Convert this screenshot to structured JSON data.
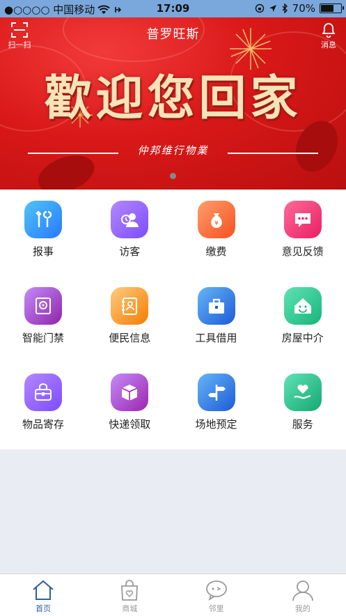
{
  "status_bar": {
    "carrier": "●○○○○ 中国移动",
    "time": "17:09",
    "battery_text": "70%",
    "battery_level": 0.7
  },
  "banner": {
    "scan_label": "扫一扫",
    "title": "普罗旺斯",
    "message_label": "消息",
    "welcome_text": "歡迎您回家",
    "brand_text": "仲邦维行物業"
  },
  "services": [
    {
      "label": "报事",
      "icon": "wrench-screwdriver-icon",
      "color_from": "#4fc3f7",
      "color_to": "#2979ff"
    },
    {
      "label": "访客",
      "icon": "visitor-icon",
      "color_from": "#b388ff",
      "color_to": "#7c4dff"
    },
    {
      "label": "缴费",
      "icon": "money-bag-icon",
      "color_from": "#ff9e6d",
      "color_to": "#f4511e"
    },
    {
      "label": "意见反馈",
      "icon": "chat-bubble-icon",
      "color_from": "#ff6b9a",
      "color_to": "#e91e63"
    },
    {
      "label": "智能门禁",
      "icon": "safe-icon",
      "color_from": "#c58af9",
      "color_to": "#8e24aa"
    },
    {
      "label": "便民信息",
      "icon": "contact-book-icon",
      "color_from": "#ffcc80",
      "color_to": "#f57c00"
    },
    {
      "label": "工具借用",
      "icon": "toolbox-icon",
      "color_from": "#64b5f6",
      "color_to": "#1e5bd8"
    },
    {
      "label": "房屋中介",
      "icon": "house-icon",
      "color_from": "#5fe3b4",
      "color_to": "#17b57a"
    },
    {
      "label": "物品寄存",
      "icon": "bag-icon",
      "color_from": "#b388ff",
      "color_to": "#7c4dff"
    },
    {
      "label": "快递领取",
      "icon": "package-icon",
      "color_from": "#c58af9",
      "color_to": "#9c27b0"
    },
    {
      "label": "场地预定",
      "icon": "signpost-icon",
      "color_from": "#64b5f6",
      "color_to": "#1e5bd8"
    },
    {
      "label": "服务",
      "icon": "heart-hand-icon",
      "color_from": "#5fe3b4",
      "color_to": "#14a873"
    }
  ],
  "tabs": [
    {
      "label": "首页",
      "icon": "home-icon",
      "active": true
    },
    {
      "label": "商城",
      "icon": "shopping-bag-icon",
      "active": false
    },
    {
      "label": "邻里",
      "icon": "chat-icon",
      "active": false
    },
    {
      "label": "我的",
      "icon": "user-icon",
      "active": false
    }
  ],
  "colors": {
    "status_bar_bg": "#7aa8dd",
    "banner_red": "#d91818",
    "tab_active": "#2b5f9e",
    "tab_inactive": "#999999",
    "page_bg": "#e9edf3"
  }
}
